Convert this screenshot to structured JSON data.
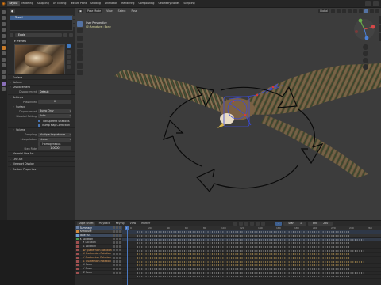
{
  "topbar": {
    "logo": "",
    "workspaces": [
      "Layout",
      "Modeling",
      "Sculpting",
      "UV Editing",
      "Texture Paint",
      "Shading",
      "Animation",
      "Rendering",
      "Compositing",
      "Geometry Nodes",
      "Scripting"
    ],
    "active_workspace": "Layout"
  },
  "properties": {
    "slot_name": "Tessel",
    "slot_button": "",
    "material_name": "Eagle",
    "sections": {
      "preview": "Preview",
      "surface": "Surface",
      "volume": "Volume",
      "displacement": "Displacement",
      "settings": "Settings",
      "settings_surface": "Surface",
      "settings_volume": "Volume",
      "line_art": "Material Line Art",
      "line_art_label": "Line Art",
      "viewport_display": "Viewport Display",
      "custom_properties": "Custom Properties"
    },
    "displacement_label": "Displacement",
    "displacement_value": "Default",
    "pass_index_label": "Pass Index",
    "pass_index_value": "0",
    "blend_mode_label": "Displacement",
    "blend_mode_value": "Bump Only",
    "shadow_mode_label": "Blended Setting",
    "shadow_mode_value": "Auto",
    "transparent_shadows": "Transparent Shadows",
    "bump_map_correction": "Bump Map Correction",
    "sampling_label": "Sampling",
    "sampling_value": "Multiple Importance",
    "interpolation_label": "Interpolation",
    "interpolation_value": "Linear",
    "homogeneous": "Homogeneous",
    "step_rate_label": "Step Rate",
    "step_rate_value": "1.0000"
  },
  "viewport": {
    "mode": "Pose Mode",
    "menus": [
      "View",
      "Select",
      "Pose"
    ],
    "transform_orientation": "Global",
    "perspective_label": "User Perspective",
    "object_label": "(0) Armature : Bone"
  },
  "timeline": {
    "editor_mode": "Dope Sheet",
    "menus": [
      "Playback",
      "Keying",
      "View",
      "Marker"
    ],
    "frame_buttons": [
      "1",
      "Start",
      "1",
      "End",
      "250"
    ],
    "current_frame": "1",
    "ruler_ticks": [
      "0",
      "20",
      "40",
      "60",
      "80",
      "100",
      "120",
      "140",
      "160",
      "180",
      "200",
      "220",
      "240",
      "260"
    ],
    "channels": [
      {
        "name": "Summary",
        "kind": "summary"
      },
      {
        "name": "Armature",
        "kind": "obj"
      },
      {
        "name": "Take 001",
        "kind": "action"
      },
      {
        "name": "X Location",
        "kind": "group"
      },
      {
        "name": "Y Location",
        "kind": "bone"
      },
      {
        "name": "Z Location",
        "kind": "bone"
      },
      {
        "name": "W Quaternion Rotation",
        "kind": "bone",
        "highlight": true
      },
      {
        "name": "X Quaternion Rotation",
        "kind": "bone",
        "highlight": true
      },
      {
        "name": "Y Quaternion Rotation",
        "kind": "bone",
        "highlight": true
      },
      {
        "name": "Z Quaternion Rotation",
        "kind": "bone",
        "highlight": true
      },
      {
        "name": "X Scale",
        "kind": "bone"
      },
      {
        "name": "Y Scale",
        "kind": "bone"
      },
      {
        "name": "Z Scale",
        "kind": "bone"
      }
    ]
  },
  "colors": {
    "accent_blue": "#4a78c0",
    "selection": "#3e5f8e",
    "orange": "#e87d0d",
    "viewport_bg": "#3c3c3c"
  }
}
